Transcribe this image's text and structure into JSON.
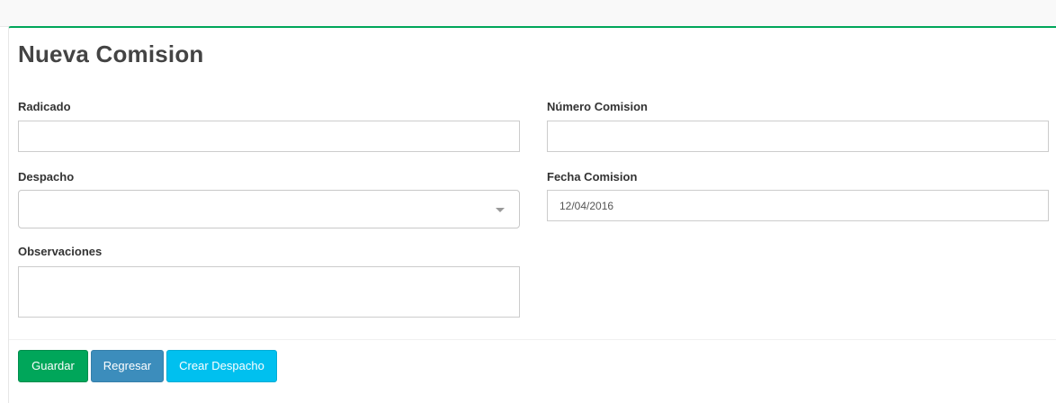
{
  "form": {
    "title": "Nueva Comision",
    "radicado": {
      "label": "Radicado",
      "value": ""
    },
    "numero_comision": {
      "label": "Número Comision",
      "value": ""
    },
    "despacho": {
      "label": "Despacho",
      "selected": ""
    },
    "fecha_comision": {
      "label": "Fecha Comision",
      "value": "12/04/2016"
    },
    "observaciones": {
      "label": "Observaciones",
      "value": ""
    }
  },
  "buttons": {
    "guardar": "Guardar",
    "regresar": "Regresar",
    "crear_despacho": "Crear Despacho"
  },
  "colors": {
    "success": "#00a65a",
    "primary": "#3c8dbc",
    "info": "#00c0ef"
  }
}
